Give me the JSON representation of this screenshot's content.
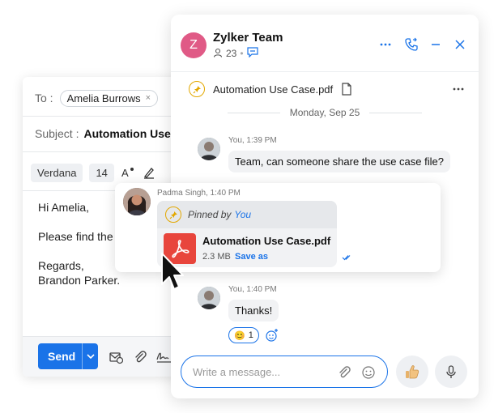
{
  "email": {
    "to_label": "To :",
    "recipient": "Amelia Burrows",
    "recipient_remove": "×",
    "subject_label": "Subject :",
    "subject_value": "Automation Use Case",
    "font_family": "Verdana",
    "font_size": "14",
    "body": "Hi Amelia,\n\nPlease find the\n\nRegards,\nBrandon Parker.",
    "send_label": "Send"
  },
  "chat": {
    "avatar_letter": "Z",
    "title": "Zylker Team",
    "member_count": "23",
    "pinned_file": "Automation Use Case.pdf",
    "date_separator": "Monday, Sep 25",
    "messages": [
      {
        "meta": "You, 1:39 PM",
        "text": "Team, can someone share the use case file?"
      },
      {
        "meta": "You, 1:40 PM",
        "text": "Thanks!"
      }
    ],
    "highlight": {
      "meta": "Padma Singh, 1:40 PM",
      "pinned_by": "Pinned by",
      "pinned_by_user": "You",
      "file_name": "Automation Use Case.pdf",
      "file_size": "2.3 MB",
      "save_label": "Save as"
    },
    "reaction_emoji": "😊",
    "reaction_count": "1",
    "compose_placeholder": "Write a message...",
    "accent_color": "#1a73e8",
    "avatar_color": "#e05a86",
    "pdf_color": "#e8453c",
    "pin_color": "#e3a800"
  }
}
